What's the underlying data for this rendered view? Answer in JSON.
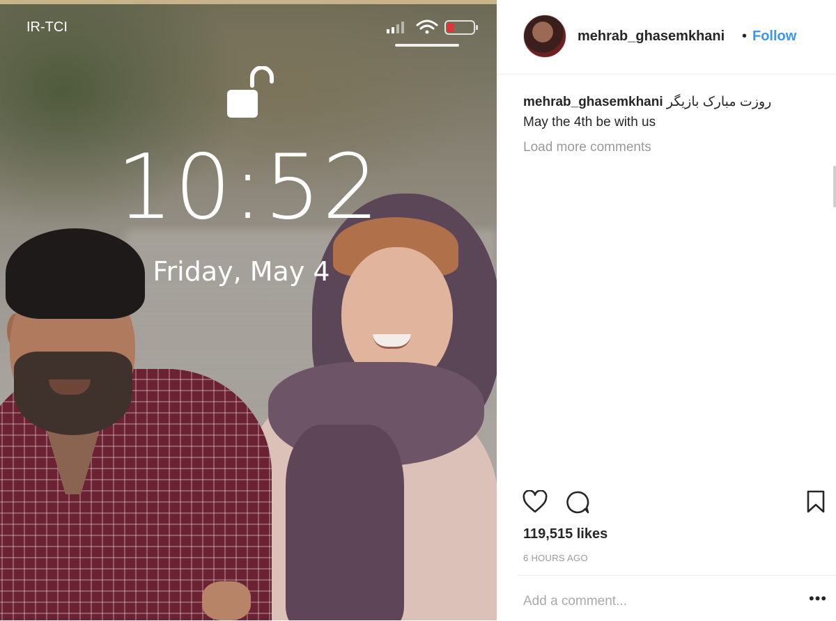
{
  "lockscreen": {
    "carrier": "IR-TCI",
    "time": "10:52",
    "date": "Friday, May 4"
  },
  "post": {
    "username": "mehrab_ghasemkhani",
    "separator": "•",
    "follow_label": "Follow",
    "caption_username": "mehrab_ghasemkhani",
    "caption_text_fa": "روزت مبارک بازیگر",
    "caption_text_en": "May the 4th be with us",
    "load_more": "Load more comments",
    "likes": "119,515 likes",
    "time_ago": "6 HOURS AGO",
    "comment_placeholder": "Add a comment...",
    "more_label": "•••"
  },
  "icons": {
    "lock": "unlocked-padlock-icon",
    "signal": "cellular-signal-icon",
    "wifi": "wifi-icon",
    "battery": "battery-icon",
    "like": "heart-icon",
    "comment": "comment-bubble-icon",
    "save": "bookmark-icon"
  },
  "colors": {
    "follow": "#3897f0",
    "battery_low": "#e0343a",
    "text": "#262626",
    "muted": "#999999"
  }
}
